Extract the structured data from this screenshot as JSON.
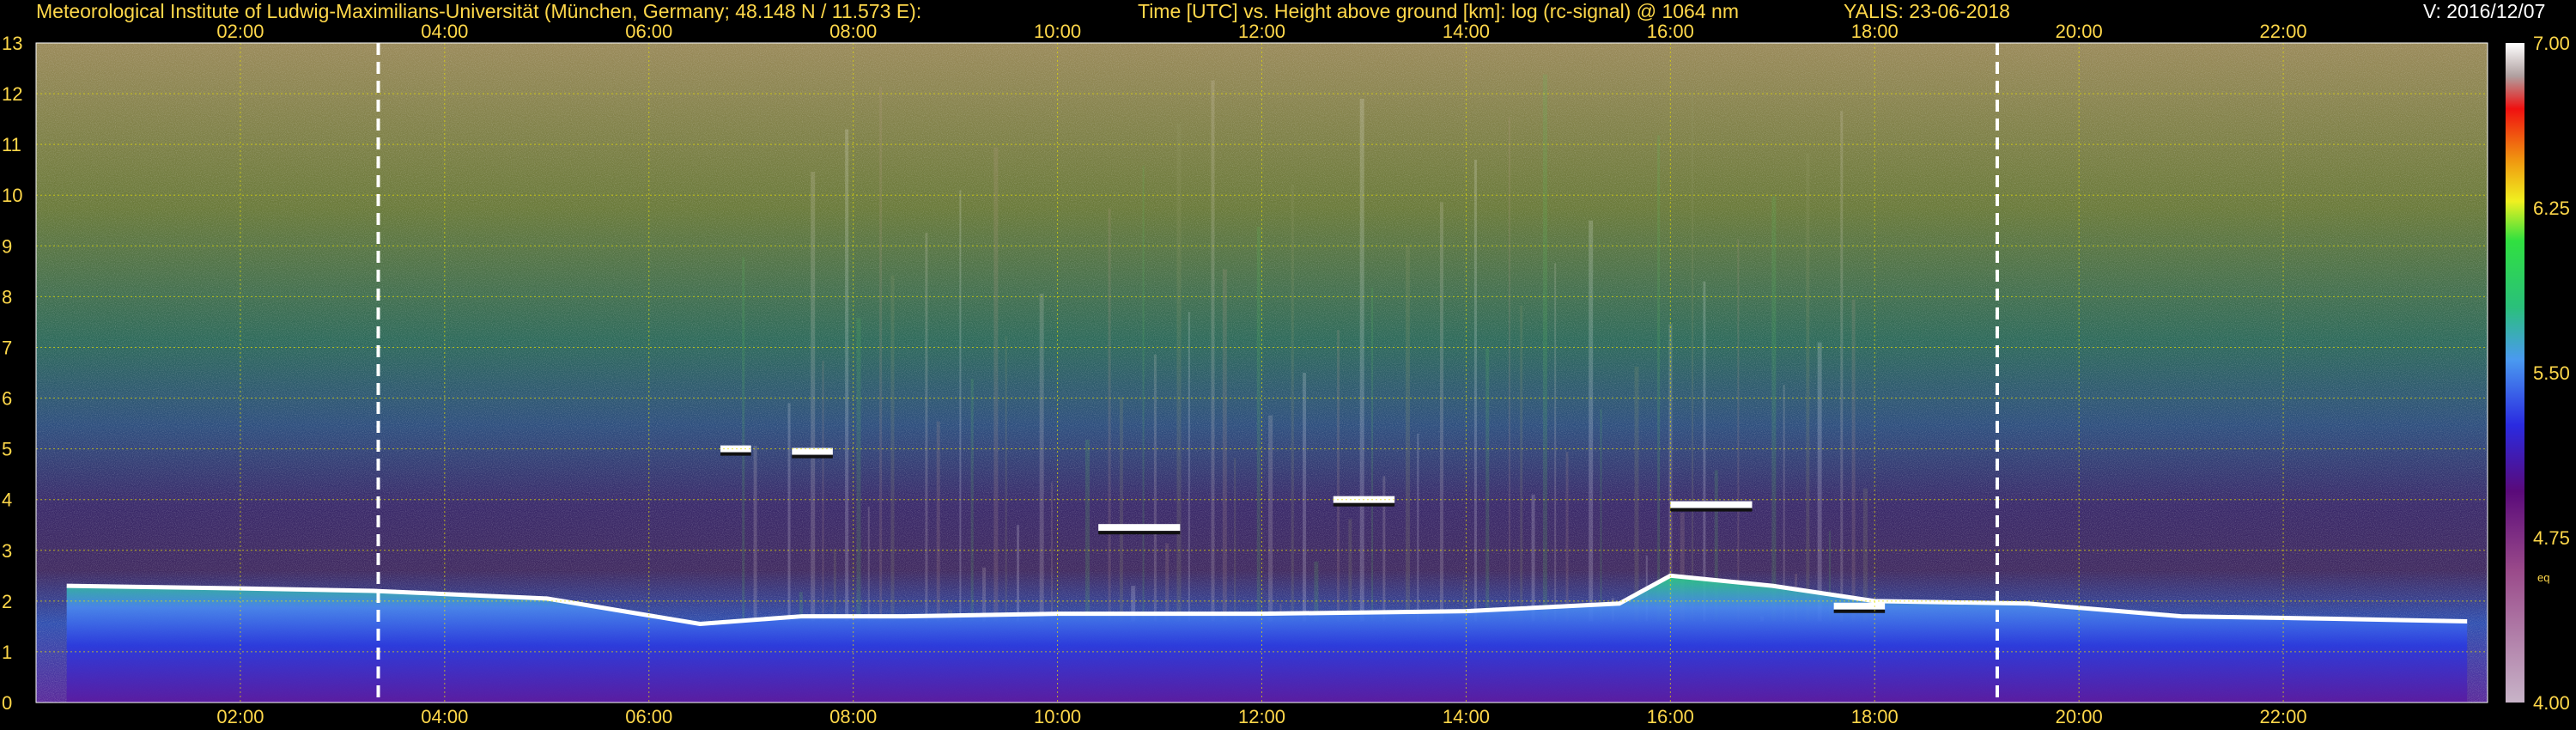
{
  "header": {
    "institute": "Meteorological Institute of Ludwig-Maximilians-Universität (München, Germany; 48.148 N / 11.573 E):",
    "title": "Time [UTC] vs. Height above ground [km]: log (rc-signal) @ 1064 nm",
    "instrument_date": "YALIS: 23-06-2018",
    "version": "V: 2016/12/07"
  },
  "colors": {
    "text": "#ffd84a",
    "background": "#000000",
    "grid": "#e8e000"
  },
  "chart_data": {
    "type": "heatmap",
    "title": "Time [UTC] vs. Height above ground [km]: log (rc-signal) @ 1064 nm",
    "x": {
      "unit": "UTC",
      "range": [
        0,
        24
      ],
      "ticks": [
        2,
        4,
        6,
        8,
        10,
        12,
        14,
        16,
        18,
        20,
        22
      ],
      "tick_labels": [
        "02:00",
        "04:00",
        "06:00",
        "08:00",
        "10:00",
        "12:00",
        "14:00",
        "16:00",
        "18:00",
        "20:00",
        "22:00"
      ]
    },
    "y": {
      "unit": "km",
      "range": [
        0,
        13
      ],
      "ticks": [
        0,
        1,
        2,
        3,
        4,
        5,
        6,
        7,
        8,
        9,
        10,
        11,
        12,
        13
      ],
      "tick_labels": [
        "0",
        "1",
        "2",
        "3",
        "4",
        "5",
        "6",
        "7",
        "8",
        "9",
        "10",
        "11",
        "12",
        "13"
      ]
    },
    "colorbar": {
      "range": [
        4.0,
        7.0
      ],
      "tick_values": [
        4.0,
        4.75,
        5.5,
        6.25,
        7.0
      ],
      "tick_labels": [
        "4.00",
        "4.75",
        "5.50",
        "6.25",
        "7.00"
      ],
      "note": "eq"
    },
    "dashed_time_markers": [
      3.35,
      19.2
    ],
    "boundary_layer_top": [
      [
        0.3,
        2.3
      ],
      [
        2.0,
        2.25
      ],
      [
        3.3,
        2.2
      ],
      [
        5.0,
        2.05
      ],
      [
        6.5,
        1.55
      ],
      [
        7.5,
        1.7
      ],
      [
        8.5,
        1.7
      ],
      [
        10.0,
        1.75
      ],
      [
        12.0,
        1.75
      ],
      [
        14.0,
        1.8
      ],
      [
        15.5,
        1.95
      ],
      [
        16.0,
        2.5
      ],
      [
        17.0,
        2.3
      ],
      [
        18.0,
        2.0
      ],
      [
        19.5,
        1.95
      ],
      [
        21.0,
        1.7
      ],
      [
        22.5,
        1.65
      ],
      [
        23.8,
        1.6
      ]
    ],
    "cloud_layers": [
      {
        "start": 6.7,
        "end": 7.0,
        "height": 5.0
      },
      {
        "start": 7.4,
        "end": 7.8,
        "height": 4.95
      },
      {
        "start": 10.4,
        "end": 11.2,
        "height": 3.45
      },
      {
        "start": 12.7,
        "end": 13.3,
        "height": 4.0
      },
      {
        "start": 16.0,
        "end": 16.8,
        "height": 3.9
      },
      {
        "start": 17.6,
        "end": 18.1,
        "height": 1.9
      }
    ]
  }
}
